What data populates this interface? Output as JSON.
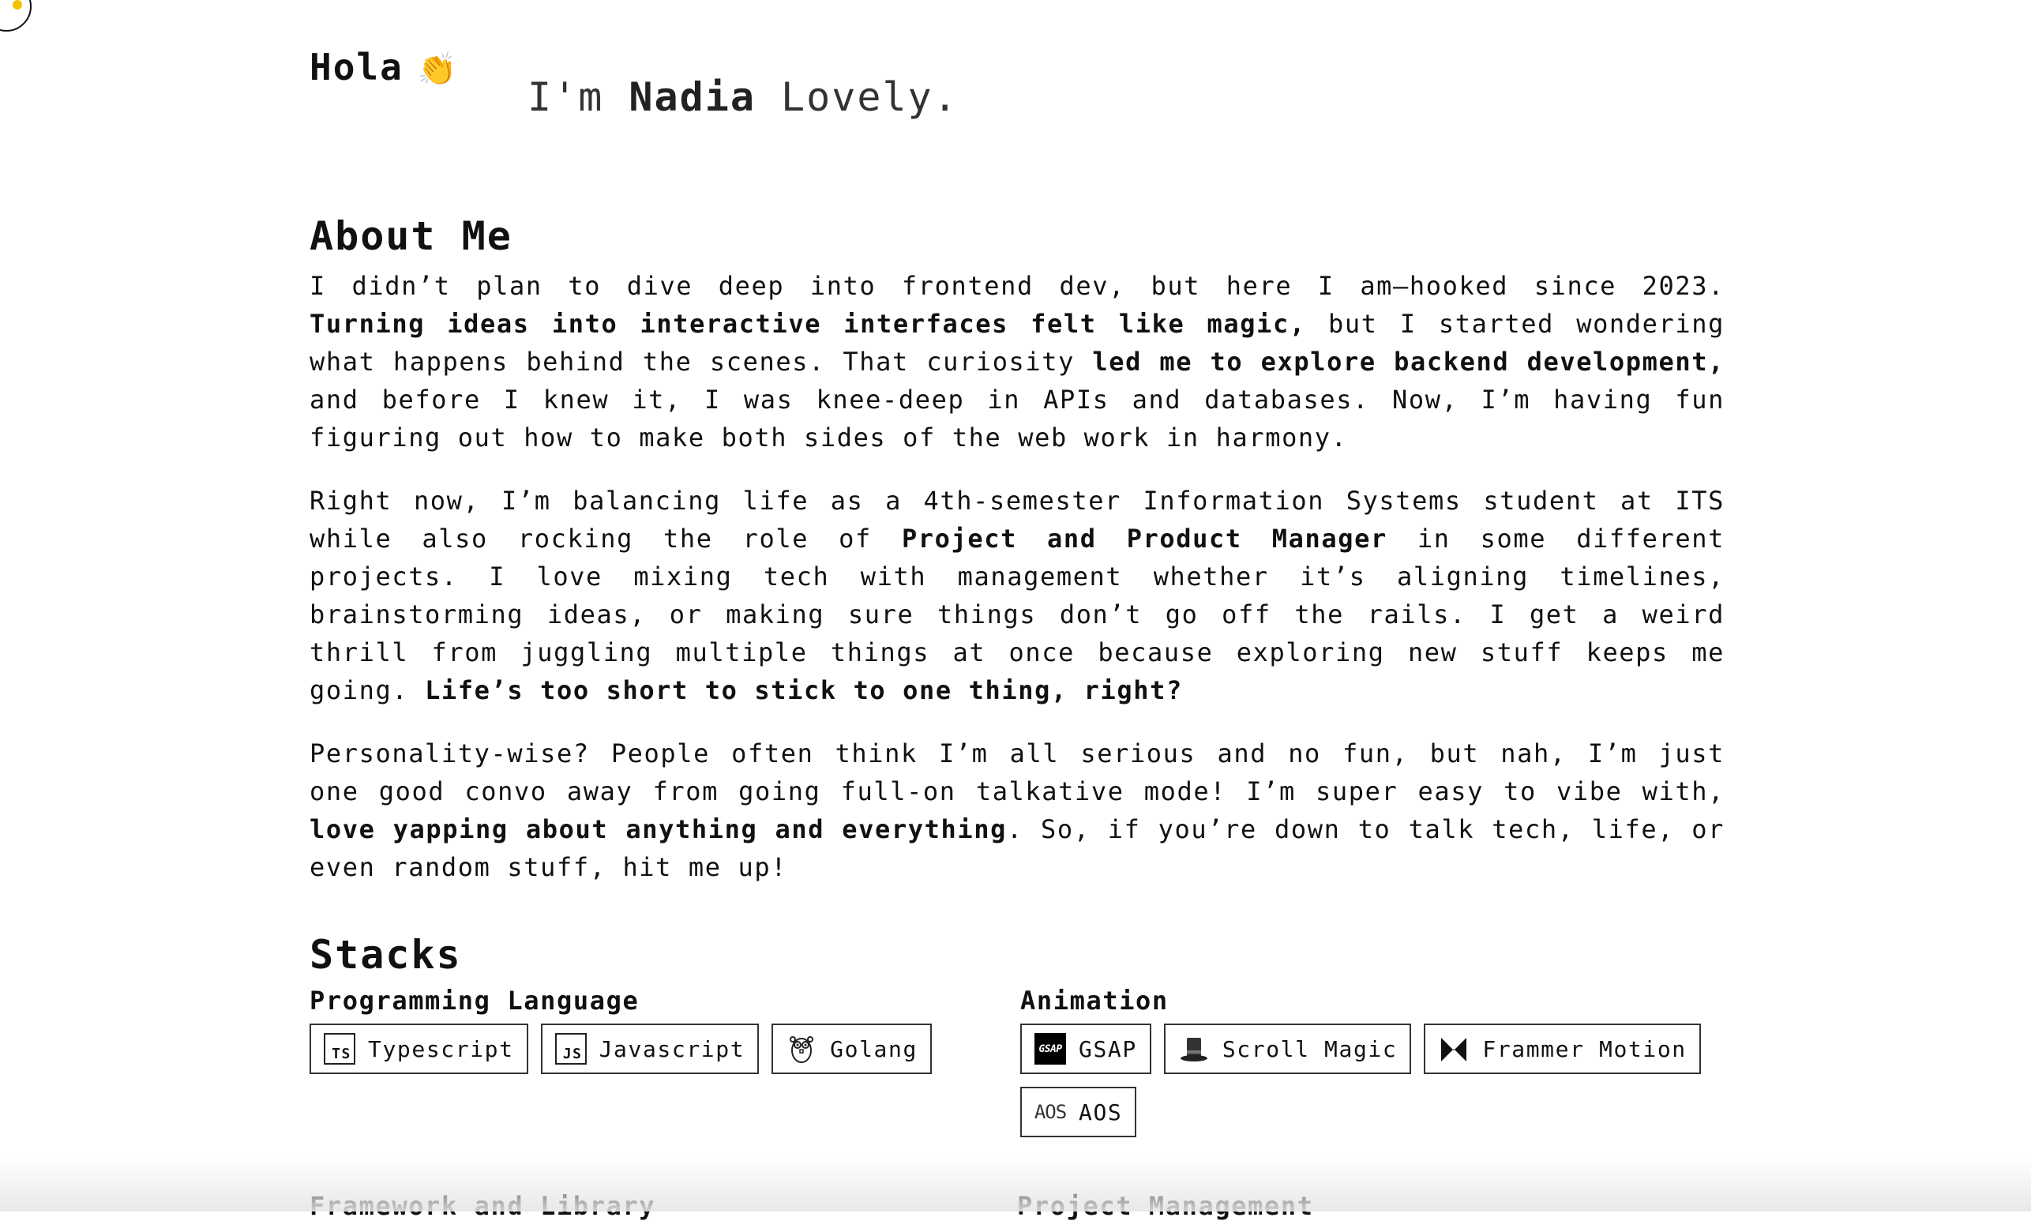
{
  "hero": {
    "greeting": "Hola",
    "wave_emoji": "👏",
    "intro_prefix": "I'm",
    "intro_name": "Nadia",
    "intro_last": "Lovely."
  },
  "about": {
    "title": "About Me",
    "p1": [
      {
        "text": "I didn’t plan to dive deep into frontend dev, but here I am—hooked since 2023. ",
        "bold": false
      },
      {
        "text": "Turning ideas into interactive interfaces felt like magic,",
        "bold": true
      },
      {
        "text": " but I started wondering what happens behind the scenes. That curiosity ",
        "bold": false
      },
      {
        "text": "led me to explore backend development,",
        "bold": true
      },
      {
        "text": " and before I knew it, I was knee-deep in APIs and databases. Now, I’m having fun figuring out how to make both sides of the web work in harmony.",
        "bold": false
      }
    ],
    "p2": [
      {
        "text": "Right now, I’m balancing life as a 4th-semester Information Systems student at ITS while also rocking the role of ",
        "bold": false
      },
      {
        "text": "Project and Product Manager",
        "bold": true
      },
      {
        "text": " in some different projects. I love mixing tech with management whether it’s aligning timelines, brainstorming ideas, or making sure things don’t go off the rails. I get a weird thrill from juggling multiple things at once because exploring new stuff keeps me going. ",
        "bold": false
      },
      {
        "text": "Life’s too short to stick to one thing, right?",
        "bold": true
      }
    ],
    "p3": [
      {
        "text": "Personality-wise? People often think I’m all serious and no fun, but nah, I’m just one good convo away from going full-on talkative mode! I’m super easy to vibe with, ",
        "bold": false
      },
      {
        "text": "love yapping about anything and everything",
        "bold": true
      },
      {
        "text": ". So, if you’re down to talk tech, life, or even random stuff, hit me up!",
        "bold": false
      }
    ]
  },
  "stacks": {
    "title": "Stacks",
    "programming": {
      "title": "Programming Language",
      "items": [
        {
          "label": "Typescript",
          "icon": "typescript-icon",
          "glyph": "TS"
        },
        {
          "label": "Javascript",
          "icon": "javascript-icon",
          "glyph": "JS"
        },
        {
          "label": "Golang",
          "icon": "gopher-icon",
          "glyph": ""
        }
      ]
    },
    "animation": {
      "title": "Animation",
      "items": [
        {
          "label": "GSAP",
          "icon": "gsap-icon",
          "glyph": "GSAP"
        },
        {
          "label": "Scroll Magic",
          "icon": "top-hat-icon",
          "glyph": ""
        },
        {
          "label": "Frammer Motion",
          "icon": "framer-motion-icon",
          "glyph": ""
        },
        {
          "label": "AOS",
          "icon": "aos-icon",
          "glyph": "AOS"
        }
      ]
    },
    "framework_title": "Framework and Library",
    "pm_title": "Project Management"
  }
}
